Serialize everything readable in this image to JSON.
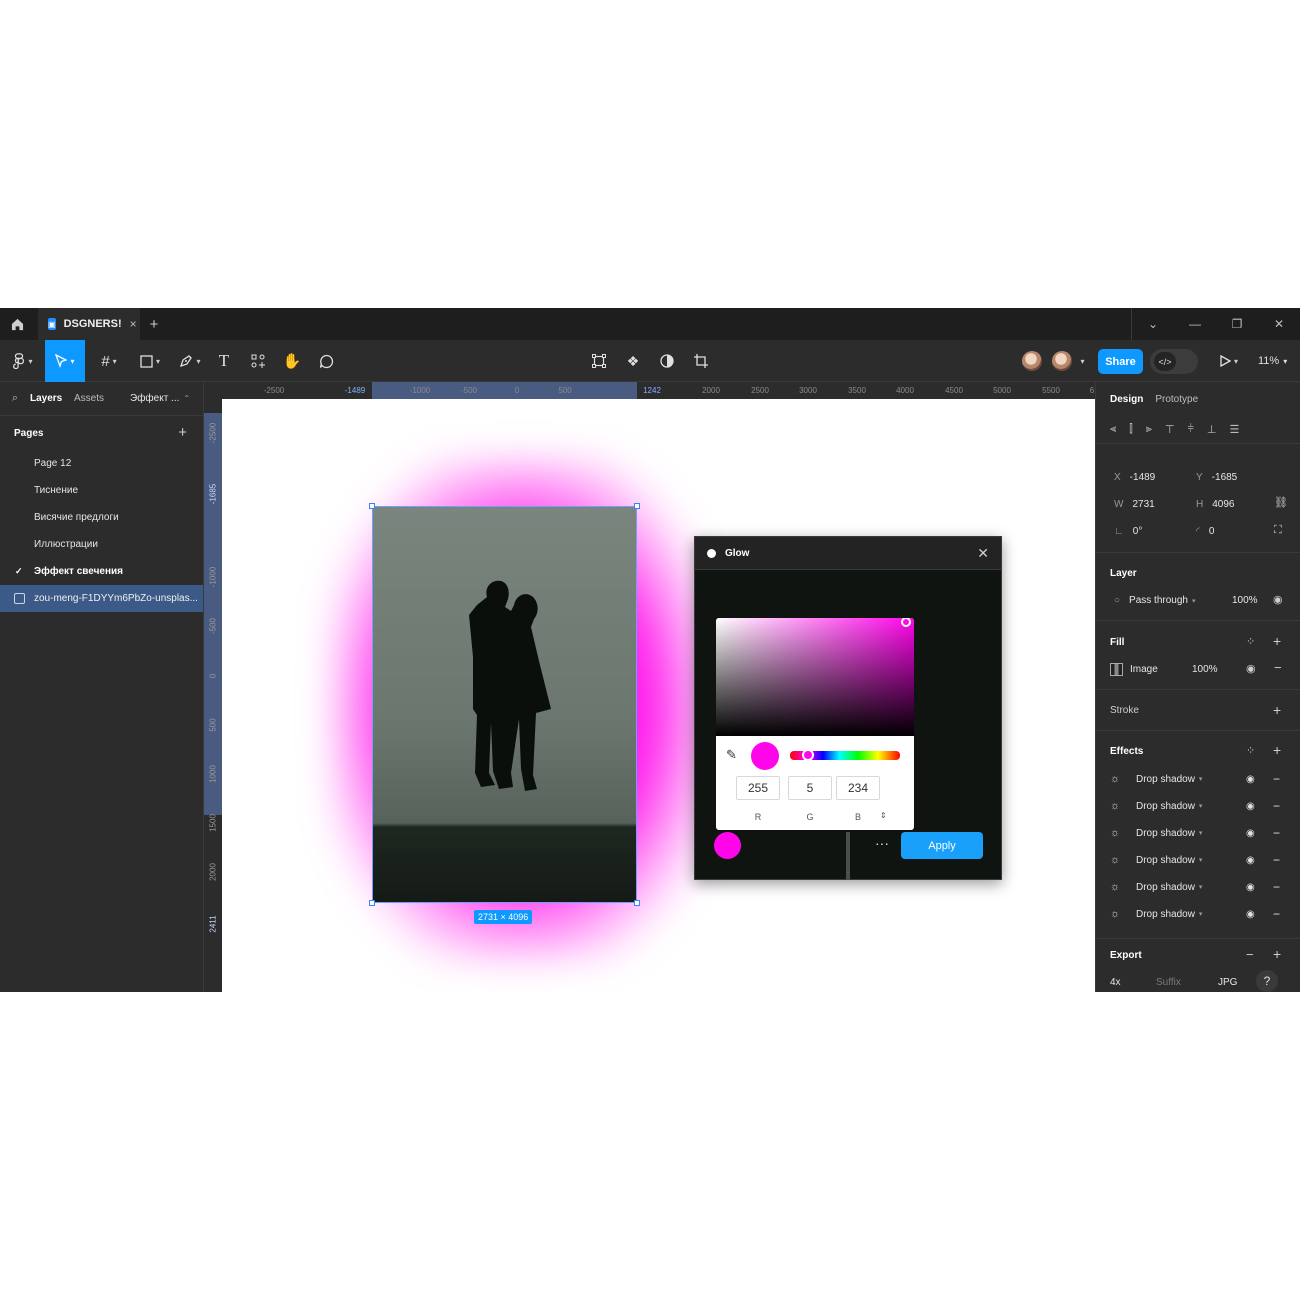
{
  "titlebar": {
    "tab_name": "DSGNERS!",
    "tab_close": "×",
    "new_tab": "+"
  },
  "toolbar": {
    "share_label": "Share",
    "zoom": "11%"
  },
  "left_panel": {
    "tabs": [
      "Layers",
      "Assets",
      "Эффект ..."
    ],
    "pages_label": "Pages",
    "pages": [
      "Page 12",
      "Тиснение",
      "Висячие предлоги",
      "Иллюстрации",
      "Эффект свечения"
    ],
    "current_page_index": 4,
    "layer": "zou-meng-F1DYYm6PbZo-unsplas..."
  },
  "rulers": {
    "top": [
      "-2500",
      "-1489",
      "-1000",
      "-500",
      "0",
      "500",
      "1242",
      "2000",
      "2500",
      "3000",
      "3500",
      "4000",
      "4500",
      "5000",
      "5500",
      "6"
    ],
    "left": [
      "-2500",
      "-1685",
      "-1000",
      "-500",
      "0",
      "500",
      "1000",
      "1500",
      "2000",
      "2411"
    ]
  },
  "canvas": {
    "dimensions_label": "2731 × 4096"
  },
  "plugin": {
    "title": "Glow",
    "color": "#ff05ea",
    "rgb": {
      "r": "255",
      "g": "5",
      "b": "234"
    },
    "labels": {
      "r": "R",
      "g": "G",
      "b": "B"
    },
    "more": "···",
    "apply_label": "Apply"
  },
  "right_panel": {
    "tabs": [
      "Design",
      "Prototype"
    ],
    "x": "-1489",
    "y": "-1685",
    "w": "2731",
    "h": "4096",
    "rotation": "0°",
    "radius": "0",
    "layer_title": "Layer",
    "blend": "Pass through",
    "layer_opacity": "100%",
    "fill_title": "Fill",
    "fill_type": "Image",
    "fill_opacity": "100%",
    "stroke_title": "Stroke",
    "effects_title": "Effects",
    "effects": [
      "Drop shadow",
      "Drop shadow",
      "Drop shadow",
      "Drop shadow",
      "Drop shadow",
      "Drop shadow"
    ],
    "export_title": "Export",
    "export_scale": "4x",
    "export_suffix": "Suffix",
    "export_format": "JPG"
  }
}
